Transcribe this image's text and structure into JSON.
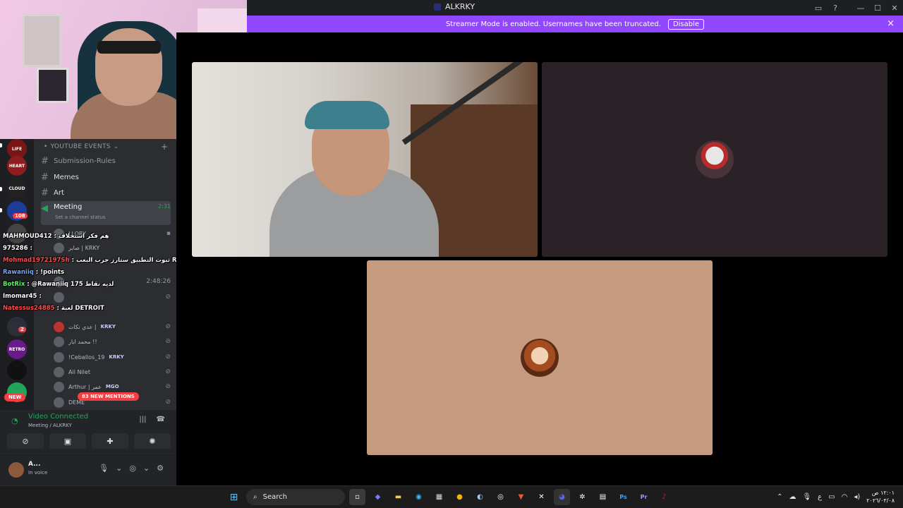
{
  "window": {
    "title": "ALKRKY"
  },
  "banner": {
    "message": "Streamer Mode is enabled. Usernames have been truncated.",
    "disable_label": "Disable",
    "close_icon": "×"
  },
  "channels": {
    "category": "YOUTUBE EVENTS",
    "items": [
      {
        "name": "Submission-Rules",
        "bold": false
      },
      {
        "name": "Memes",
        "bold": true
      },
      {
        "name": "Art",
        "bold": true
      }
    ],
    "active": {
      "name": "Meeting",
      "time": "2:31",
      "status_placeholder": "Set a channel status"
    },
    "voice_users": [
      {
        "name": "LLORY",
        "tag": ""
      },
      {
        "name": "صابر | KRKY",
        "tag": ""
      },
      {
        "name": "",
        "tag": "",
        "time": "2:48:26"
      },
      {
        "name": "",
        "tag": ""
      },
      {
        "name": "عدي نكات |",
        "tag": "KRKY"
      },
      {
        "name": "محمد ايار !!",
        "tag": ""
      },
      {
        "name": "!Ceballos_19",
        "tag": "KRKY"
      },
      {
        "name": "Ail Nilet",
        "tag": ""
      },
      {
        "name": "Arthur | عمر",
        "tag": "MGO"
      },
      {
        "name": "DEME",
        "tag": ""
      }
    ],
    "new_mentions": "83 NEW MENTIONS"
  },
  "servers": {
    "badges": [
      "108",
      "2"
    ],
    "new_label": "NEW"
  },
  "chat": [
    {
      "user": "MAHMOUD412",
      "text": " : هم فكر استخلاف"
    },
    {
      "user": "975286",
      "text": " : "
    },
    {
      "user": "Mohmad1972197Sh",
      "text": " : ثبوت التطبيق ستارز جرب البعب RV THereYet"
    },
    {
      "user": "Rawaniiq",
      "text": " : !points"
    },
    {
      "user": "BotRix",
      "text": " : @Rawaniiq 175 لديه نقاط"
    },
    {
      "user": "Imomar45",
      "text": " : "
    },
    {
      "user": "Natessus24885",
      "text": " : لعبة DETROIT"
    }
  ],
  "voice_panel": {
    "status": "Video Connected",
    "location": "Meeting / ALKRKY",
    "user_name": "A...",
    "user_status": "In voice"
  },
  "taskbar": {
    "search_label": "Search",
    "clock_time": "١٢:٠١ ص",
    "clock_date": "٢٠٢٦/٠٣/٠٨",
    "lang": "ع"
  },
  "colors": {
    "banner": "#9146ff",
    "accent_green": "#23a559",
    "danger": "#f23f43"
  }
}
